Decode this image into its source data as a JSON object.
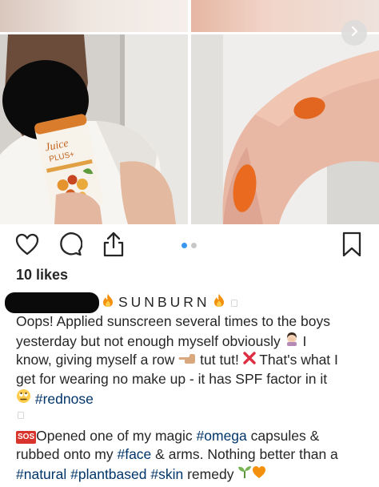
{
  "post": {
    "likes_text": "10 likes",
    "product_label_line1": "Juice",
    "product_label_line2": "PLUS+",
    "carousel": {
      "current_index": 1,
      "total": 2
    }
  },
  "caption": {
    "title": "SUNBURN",
    "line1": "Oops! Applied sunscreen several times to the boys",
    "line2a": "yesterday but not enough myself obviously",
    "line2b": "I",
    "line3a": "know, giving myself a row",
    "line3b": "tut tut!",
    "line3c": "That's what I",
    "line4": "get for wearing no make up - it has SPF factor in it",
    "tag_rednose": "#rednose",
    "sos_label": "SOS",
    "p2_a": "Opened one of my magic",
    "tag_omega": "#omega",
    "p2_b": "capsules &",
    "p2_c": "rubbed onto my",
    "tag_face": "#face",
    "p2_d": "& arms. Nothing better than a",
    "tag_natural": "#natural",
    "tag_plantbased": "#plantbased",
    "tag_skin": "#skin",
    "p2_e": "remedy"
  },
  "colors": {
    "hashtag": "#003569",
    "carousel_active_dot": "#3897f0",
    "carousel_inactive_dot": "#c7c7c7",
    "text": "#262626"
  },
  "icons": [
    "heart-icon",
    "comment-icon",
    "share-icon",
    "bookmark-icon",
    "chevron-right-icon",
    "fire-icon",
    "woman-facepalming-icon",
    "backhand-pointing-icon",
    "cross-mark-icon",
    "rolling-eyes-icon",
    "seedling-icon",
    "orange-heart-icon"
  ]
}
